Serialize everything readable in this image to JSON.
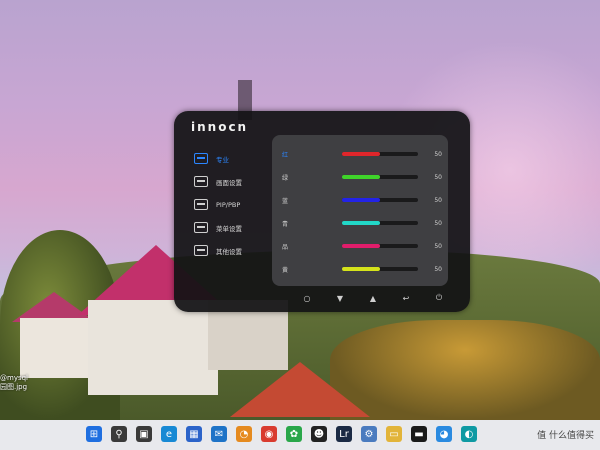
{
  "desktop": {
    "file_label_line1": "@mysql",
    "file_label_line2": "园图.jpg"
  },
  "osd": {
    "brand": "innocn",
    "menu": [
      {
        "label": "专业",
        "icon": "monitor-icon",
        "active": true
      },
      {
        "label": "画面设置",
        "icon": "display-settings-icon",
        "active": false
      },
      {
        "label": "PIP/PBP",
        "icon": "pip-icon",
        "active": false
      },
      {
        "label": "菜单设置",
        "icon": "menu-list-icon",
        "active": false
      },
      {
        "label": "其他设置",
        "icon": "other-settings-icon",
        "active": false
      }
    ],
    "color_rows": [
      {
        "label": "红",
        "value": "50",
        "level": 0.5,
        "color": "#e0262b",
        "active": true
      },
      {
        "label": "绿",
        "value": "50",
        "level": 0.5,
        "color": "#3fd32a",
        "active": false
      },
      {
        "label": "蓝",
        "value": "50",
        "level": 0.5,
        "color": "#2323e6",
        "active": false
      },
      {
        "label": "青",
        "value": "50",
        "level": 0.5,
        "color": "#22d8c8",
        "active": false
      },
      {
        "label": "品",
        "value": "50",
        "level": 0.5,
        "color": "#e11d6b",
        "active": false
      },
      {
        "label": "黄",
        "value": "50",
        "level": 0.5,
        "color": "#d5e31b",
        "active": false
      }
    ],
    "nav": [
      "○",
      "▼",
      "▲",
      "↩",
      "⏻"
    ]
  },
  "taskbar": {
    "icons": [
      {
        "name": "windows-start-icon",
        "glyph": "⊞",
        "color": "#1f6fe0"
      },
      {
        "name": "search-icon",
        "glyph": "⚲",
        "color": "#3a3a3a"
      },
      {
        "name": "task-view-icon",
        "glyph": "▣",
        "color": "#3a3a3a"
      },
      {
        "name": "edge-icon",
        "glyph": "e",
        "color": "#1789d4"
      },
      {
        "name": "store-icon",
        "glyph": "▦",
        "color": "#2b63c9"
      },
      {
        "name": "mail-icon",
        "glyph": "✉",
        "color": "#1e73c7"
      },
      {
        "name": "app-orange-icon",
        "glyph": "◔",
        "color": "#e58a1f"
      },
      {
        "name": "chrome-icon",
        "glyph": "◉",
        "color": "#d93b2f"
      },
      {
        "name": "app-green-icon",
        "glyph": "✿",
        "color": "#2aa74a"
      },
      {
        "name": "qq-icon",
        "glyph": "☻",
        "color": "#222222"
      },
      {
        "name": "lightroom-icon",
        "glyph": "Lr",
        "color": "#1b2a44"
      },
      {
        "name": "network-icon",
        "glyph": "⚙",
        "color": "#4a7bbf"
      },
      {
        "name": "folder-icon",
        "glyph": "▭",
        "color": "#e2b43a"
      },
      {
        "name": "terminal-icon",
        "glyph": "▬",
        "color": "#1a1a1a"
      },
      {
        "name": "app-blue-icon",
        "glyph": "◕",
        "color": "#2a8ae0"
      },
      {
        "name": "app-teal-icon",
        "glyph": "◐",
        "color": "#0f9aa3"
      }
    ],
    "tray_text": "值 什么值得买"
  }
}
